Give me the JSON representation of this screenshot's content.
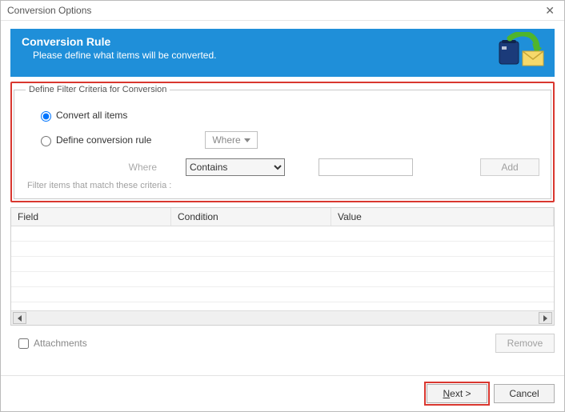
{
  "window": {
    "title": "Conversion Options"
  },
  "banner": {
    "title": "Conversion Rule",
    "subtitle": "Please define what items will be converted."
  },
  "group": {
    "legend": "Define Filter Criteria for Conversion",
    "radio": {
      "all": "Convert all items",
      "define": "Define conversion rule"
    },
    "where_button": "Where",
    "where_label": "Where",
    "condition_selected": "Contains",
    "value_text": "",
    "add_label": "Add",
    "hint": "Filter items that match these criteria :"
  },
  "table": {
    "headers": {
      "field": "Field",
      "condition": "Condition",
      "value": "Value"
    }
  },
  "below": {
    "attachments_label": "Attachments",
    "remove_label": "Remove"
  },
  "footer": {
    "next_prefix": "N",
    "next_suffix": "ext >",
    "cancel": "Cancel"
  }
}
